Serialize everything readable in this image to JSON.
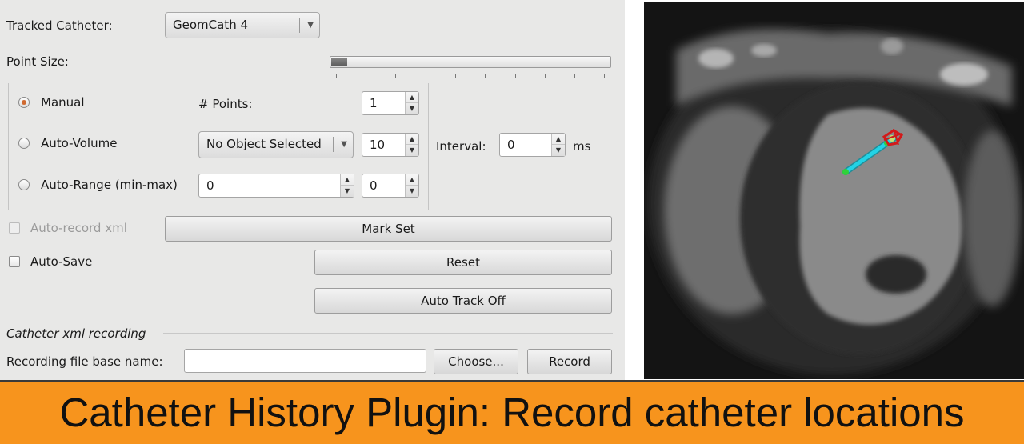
{
  "panel": {
    "tracked_catheter_label": "Tracked Catheter:",
    "tracked_catheter_value": "GeomCath 4",
    "point_size_label": "Point Size:",
    "point_size_fraction": 0.05,
    "modes": {
      "manual_label": "Manual",
      "auto_volume_label": "Auto-Volume",
      "auto_range_label": "Auto-Range (min-max)",
      "selected": "Manual"
    },
    "points_label": "# Points:",
    "points_value": "1",
    "volume_select_value": "No Object Selected",
    "auto_volume_value": "10",
    "interval_label": "Interval:",
    "interval_value": "0",
    "interval_unit": "ms",
    "range_min_value": "0",
    "range_max_value": "0",
    "auto_record_xml_label": "Auto-record xml",
    "mark_set_label": "Mark Set",
    "auto_save_label": "Auto-Save",
    "reset_label": "Reset",
    "auto_track_label": "Auto Track Off",
    "section_title": "Catheter xml recording",
    "recording_label": "Recording file base name:",
    "recording_value": "",
    "choose_label": "Choose...",
    "record_label": "Record"
  },
  "icons": {
    "dropdown": "chevron-down-icon",
    "spin_up": "arrow-up-icon",
    "spin_down": "arrow-down-icon"
  },
  "colors": {
    "banner": "#f7941d",
    "radio_checked": "#d06a30",
    "catheter": "#22d3e6"
  },
  "banner": {
    "text": "Catheter History Plugin: Record catheter locations"
  }
}
